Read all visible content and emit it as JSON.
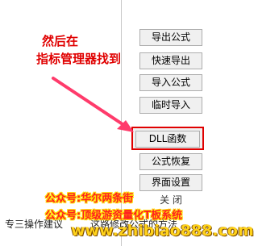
{
  "panel": {
    "buttons": [
      {
        "label": "导出公式"
      },
      {
        "label": "快速导出"
      },
      {
        "label": "导入公式"
      },
      {
        "label": "临时导入"
      },
      {
        "label": "DLL函数"
      },
      {
        "label": "公式恢复"
      },
      {
        "label": "界面设置"
      }
    ],
    "close_label": "关 闭"
  },
  "bottom": {
    "left_text": "专三操作建议",
    "right_text": "这路修改公式的方法"
  },
  "annotation": {
    "line1": "然后在",
    "line2": "指标管理器找到",
    "color": "#e00000"
  },
  "watermark": {
    "line1": "公众号:华尔两条街",
    "line2": "公众号:顶级游资量化T板系统",
    "domain": "www.zhibiao888.com"
  }
}
